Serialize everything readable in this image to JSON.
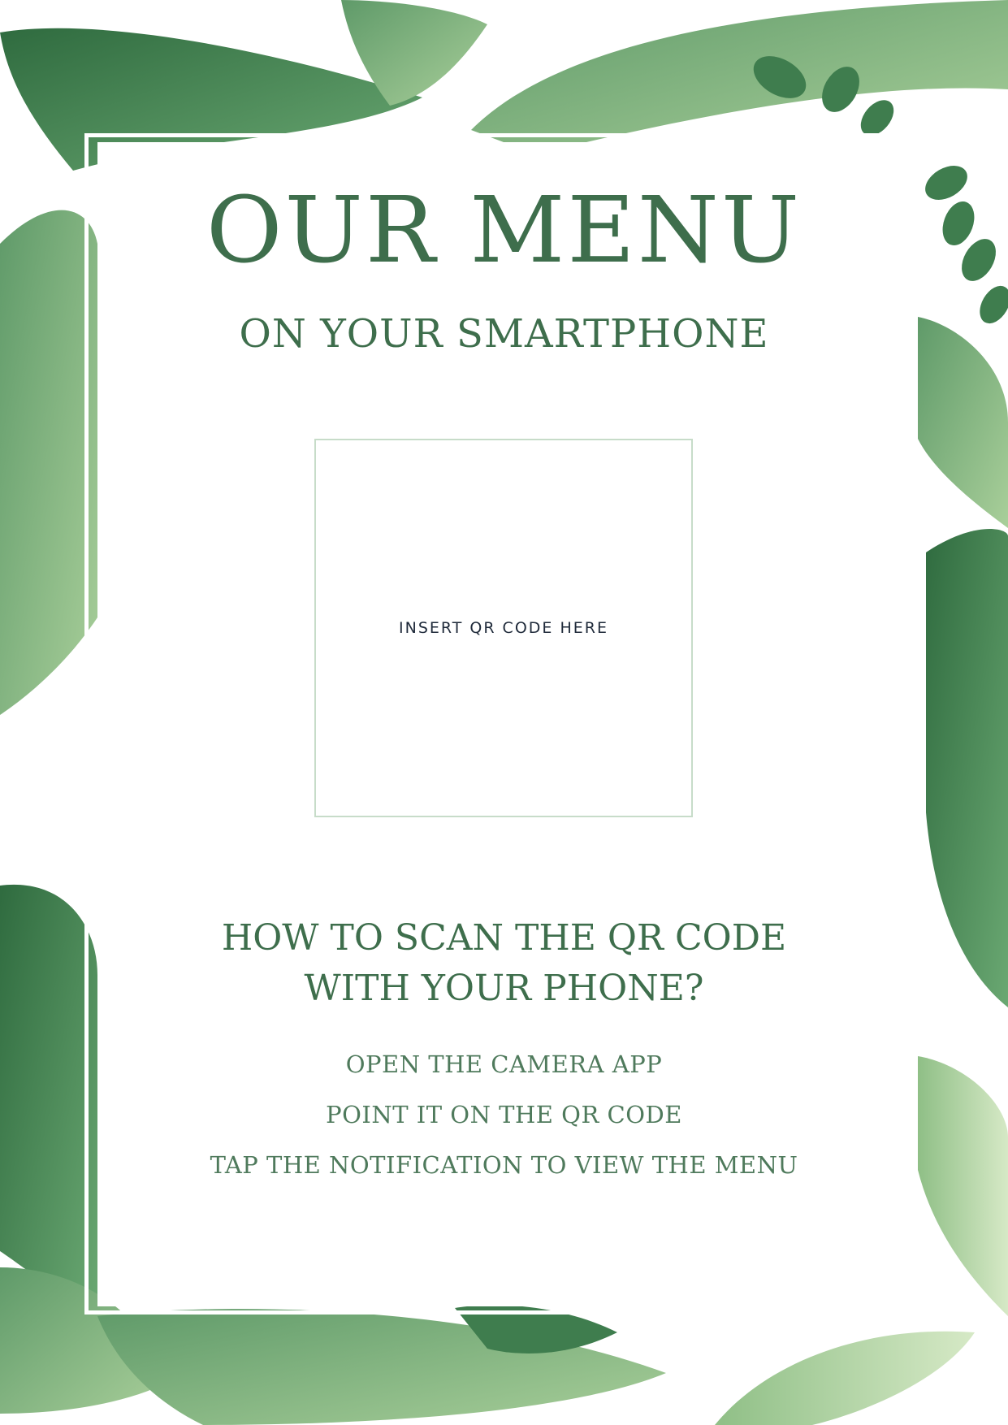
{
  "title": "OUR MENU",
  "subtitle": "ON YOUR SMARTPHONE",
  "qr_placeholder": "INSERT QR CODE HERE",
  "howto": {
    "line1": "HOW TO SCAN THE QR CODE",
    "line2": "WITH YOUR PHONE?"
  },
  "steps": [
    "OPEN THE CAMERA APP",
    "POINT IT ON THE QR CODE",
    "TAP THE NOTIFICATION TO VIEW THE MENU"
  ],
  "colors": {
    "heading": "#3e6e4c",
    "body_text": "#4f7a5c",
    "qr_label": "#1f2a3a",
    "qr_border": "#c7dcc9",
    "leaf_dark": "#3f7d4e",
    "leaf_mid": "#6aa872",
    "leaf_light": "#a9cf9a"
  },
  "decorations": [
    "tropical-leaves-background"
  ]
}
